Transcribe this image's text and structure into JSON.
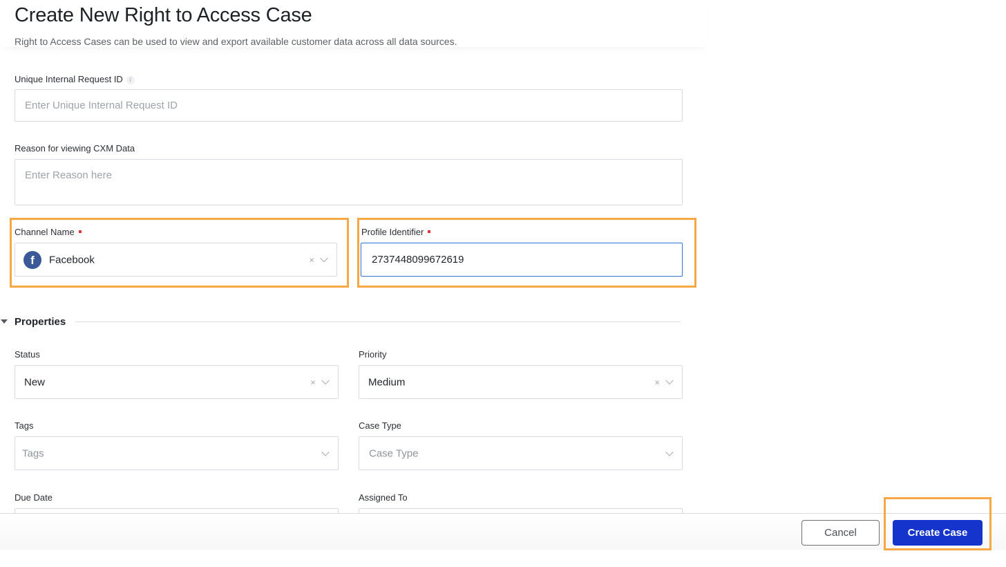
{
  "header": {
    "title": "Create New Right to Access Case",
    "subtitle": "Right to Access Cases can be used to view and export available customer data across all data sources."
  },
  "form": {
    "request_id": {
      "label": "Unique Internal Request ID",
      "info_icon": "i",
      "placeholder": "Enter Unique Internal Request ID",
      "value": ""
    },
    "reason": {
      "label": "Reason for viewing CXM Data",
      "placeholder": "Enter Reason here",
      "value": ""
    },
    "channel": {
      "label": "Channel Name",
      "required": true,
      "value": "Facebook",
      "icon": "facebook-icon",
      "icon_glyph": "f"
    },
    "profile_id": {
      "label": "Profile Identifier",
      "required": true,
      "value": "2737448099672619"
    }
  },
  "properties": {
    "section_title": "Properties",
    "expanded": true,
    "status": {
      "label": "Status",
      "value": "New"
    },
    "priority": {
      "label": "Priority",
      "value": "Medium"
    },
    "tags": {
      "label": "Tags",
      "placeholder": "Tags"
    },
    "case_type": {
      "label": "Case Type",
      "placeholder": "Case Type"
    },
    "due_date": {
      "label": "Due Date"
    },
    "assigned_to": {
      "label": "Assigned To"
    }
  },
  "icons": {
    "clear": "×"
  },
  "footer": {
    "cancel_label": "Cancel",
    "create_label": "Create Case"
  },
  "colors": {
    "primary": "#1434cb",
    "highlight": "#f7a845",
    "required": "#e0323a",
    "focus": "#3c7fd9",
    "facebook": "#3b5998"
  }
}
